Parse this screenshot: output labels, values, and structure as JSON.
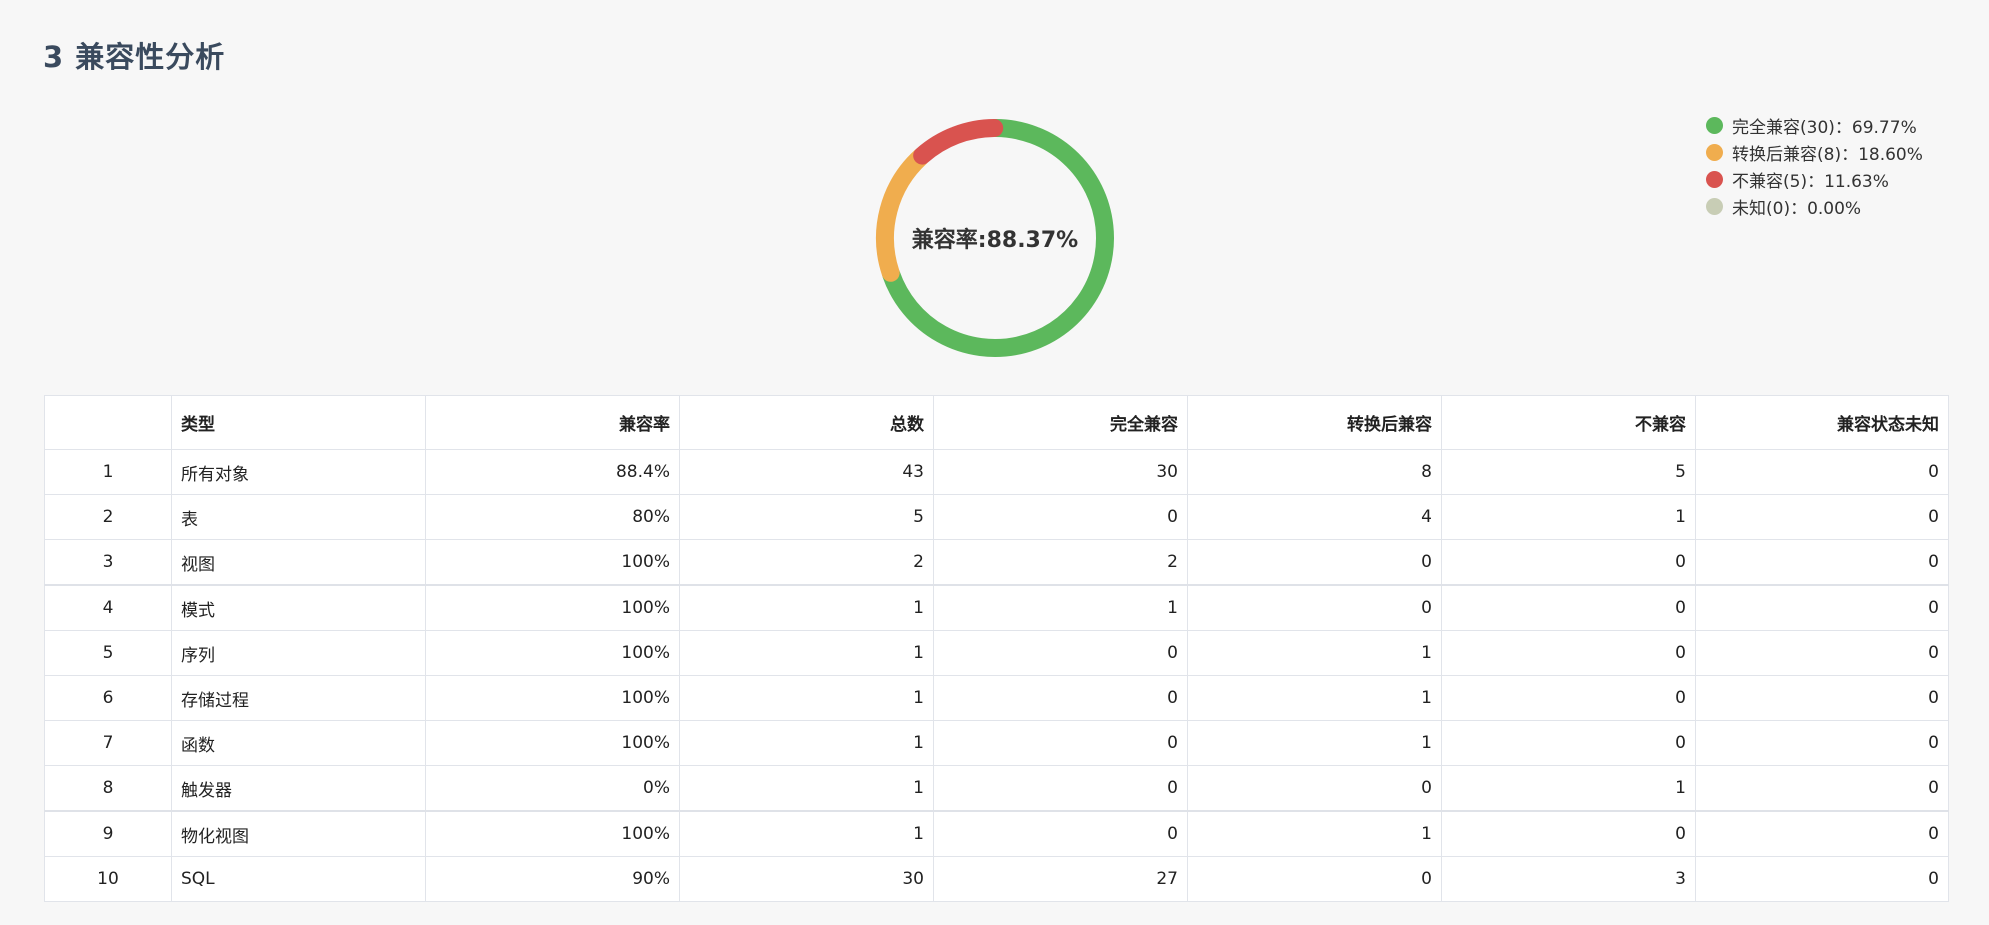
{
  "page": {
    "title": "3  兼容性分析"
  },
  "chart_data": {
    "type": "pie",
    "center_label": "兼容率:88.37%",
    "slices": [
      {
        "name": "完全兼容",
        "count": 30,
        "percent": 69.77,
        "color": "#5cb85c",
        "legend": "完全兼容(30)：69.77%"
      },
      {
        "name": "转换后兼容",
        "count": 8,
        "percent": 18.6,
        "color": "#f0ad4e",
        "legend": "转换后兼容(8)：18.60%"
      },
      {
        "name": "不兼容",
        "count": 5,
        "percent": 11.63,
        "color": "#d9534f",
        "legend": "不兼容(5)：11.63%"
      },
      {
        "name": "未知",
        "count": 0,
        "percent": 0.0,
        "color": "#c8cdb5",
        "legend": "未知(0)：0.00%"
      }
    ]
  },
  "table": {
    "headers": [
      "",
      "类型",
      "兼容率",
      "总数",
      "完全兼容",
      "转换后兼容",
      "不兼容",
      "兼容状态未知"
    ],
    "rows": [
      [
        "1",
        "所有对象",
        "88.4%",
        "43",
        "30",
        "8",
        "5",
        "0"
      ],
      [
        "2",
        "表",
        "80%",
        "5",
        "0",
        "4",
        "1",
        "0"
      ],
      [
        "3",
        "视图",
        "100%",
        "2",
        "2",
        "0",
        "0",
        "0"
      ],
      [
        "4",
        "模式",
        "100%",
        "1",
        "1",
        "0",
        "0",
        "0"
      ],
      [
        "5",
        "序列",
        "100%",
        "1",
        "0",
        "1",
        "0",
        "0"
      ],
      [
        "6",
        "存储过程",
        "100%",
        "1",
        "0",
        "1",
        "0",
        "0"
      ],
      [
        "7",
        "函数",
        "100%",
        "1",
        "0",
        "1",
        "0",
        "0"
      ],
      [
        "8",
        "触发器",
        "0%",
        "1",
        "0",
        "0",
        "1",
        "0"
      ],
      [
        "9",
        "物化视图",
        "100%",
        "1",
        "0",
        "1",
        "0",
        "0"
      ],
      [
        "10",
        "SQL",
        "90%",
        "30",
        "27",
        "0",
        "3",
        "0"
      ]
    ]
  }
}
